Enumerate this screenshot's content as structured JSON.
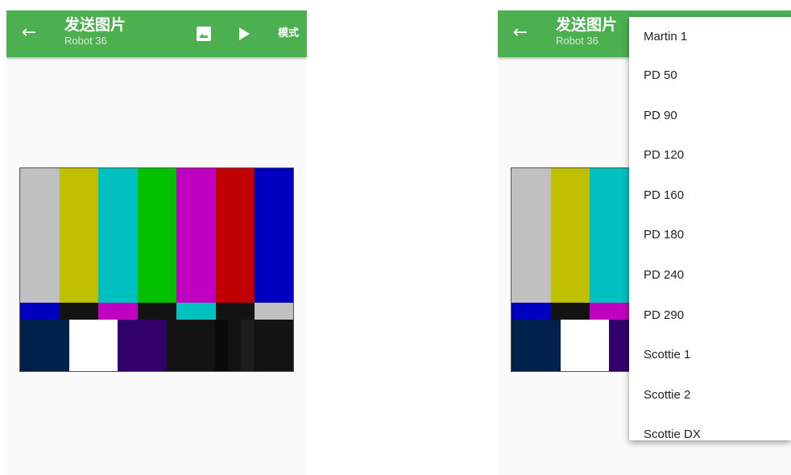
{
  "left_screen": {
    "appbar": {
      "title": "发送图片",
      "subtitle": "Robot 36",
      "back_icon": "arrow-left-icon",
      "image_icon": "image-icon",
      "play_icon": "play-icon",
      "mode_label": "模式"
    }
  },
  "right_screen": {
    "appbar": {
      "title": "发送图片",
      "subtitle": "Robot 36",
      "back_icon": "arrow-left-icon"
    },
    "mode_menu": {
      "items": [
        "Martin 1",
        "PD 50",
        "PD 90",
        "PD 120",
        "PD 160",
        "PD 180",
        "PD 240",
        "PD 290",
        "Scottie 1",
        "Scottie 2",
        "Scottie DX"
      ]
    }
  },
  "colors": {
    "appbar_green": "#4caf50",
    "background": "#fafafa",
    "test_card_top": [
      "#c0c0c0",
      "#c0c000",
      "#00c0c0",
      "#00c000",
      "#c000c0",
      "#c00000",
      "#0000c0"
    ],
    "test_card_middle": [
      "#0000c0",
      "#131313",
      "#c000c0",
      "#131313",
      "#00c0c0",
      "#131313",
      "#c0c0c0"
    ],
    "test_card_bottom": [
      "#00214c",
      "#ffffff",
      "#32006a",
      "#131313",
      "#090909",
      "#131313",
      "#1d1d1d",
      "#131313"
    ]
  }
}
